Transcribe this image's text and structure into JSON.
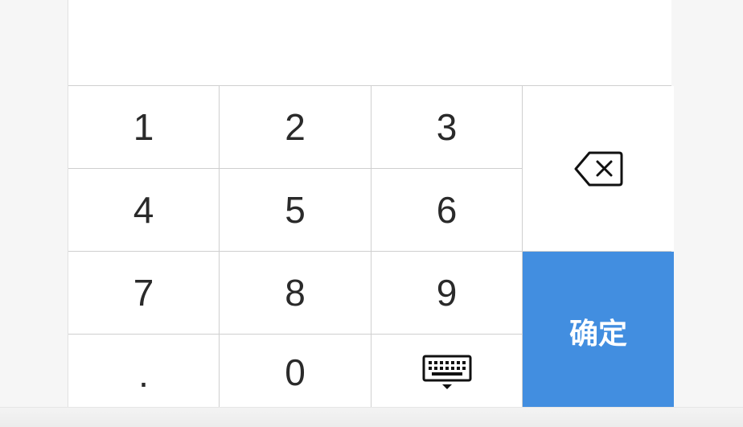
{
  "keypad": {
    "keys": [
      "1",
      "2",
      "3",
      "4",
      "5",
      "6",
      "7",
      "8",
      "9",
      ".",
      "0"
    ],
    "backspace_icon": "backspace-icon",
    "hide_keyboard_icon": "keyboard-hide-icon",
    "confirm_label": "确定"
  },
  "colors": {
    "confirm_background": "#428ee0",
    "key_background": "#ffffff",
    "divider": "#cfcfcf",
    "text": "#2a2a2a"
  }
}
